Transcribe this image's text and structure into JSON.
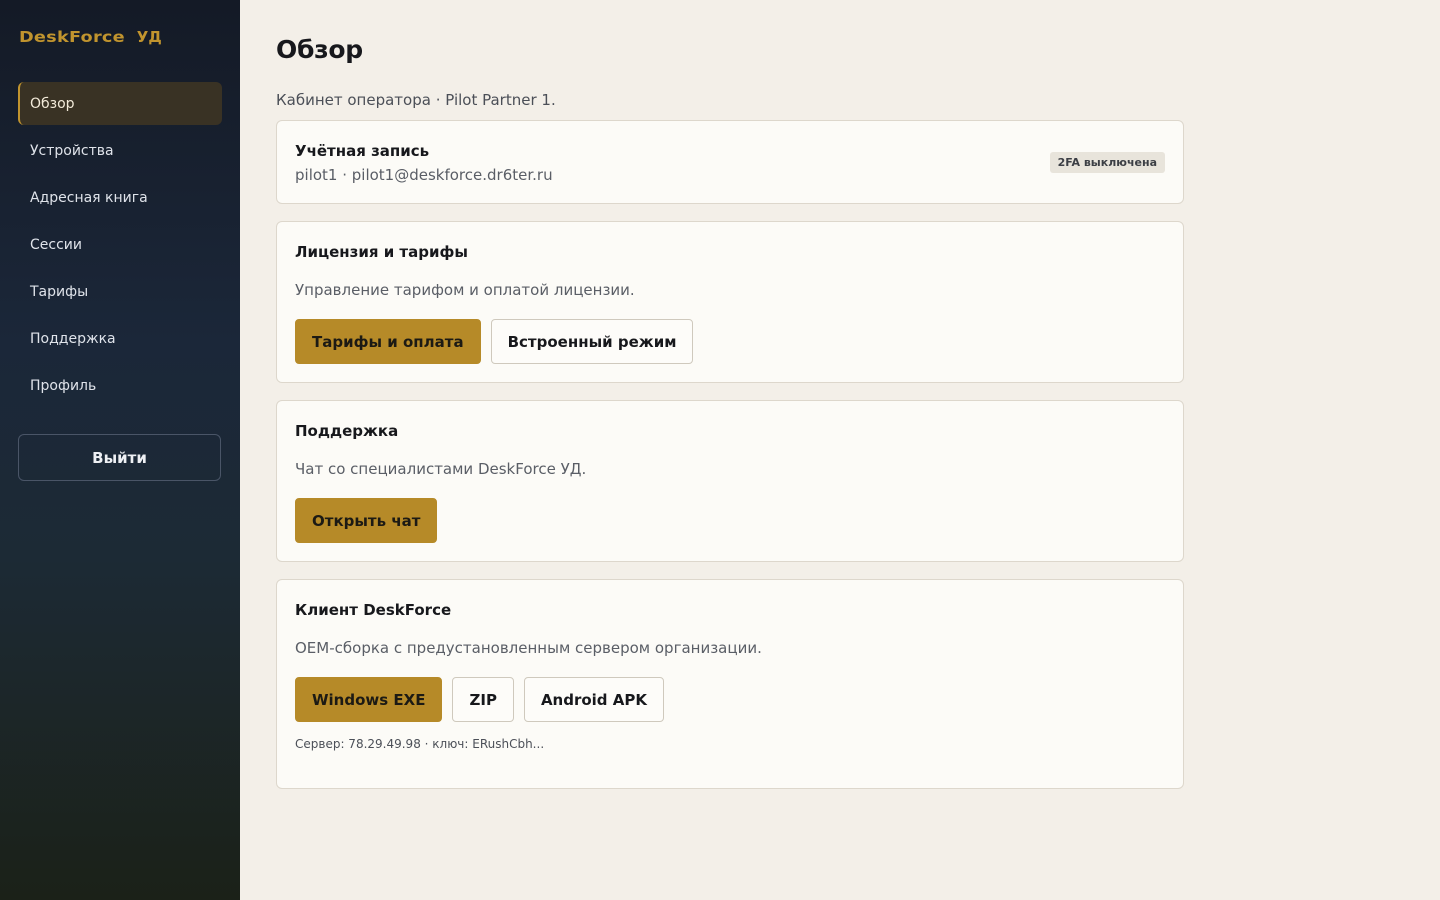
{
  "sidebar": {
    "brand": {
      "name": "DeskForce",
      "suffix": "УД"
    },
    "items": [
      {
        "label": "Обзор",
        "active": true
      },
      {
        "label": "Устройства"
      },
      {
        "label": "Адресная книга"
      },
      {
        "label": "Сессии"
      },
      {
        "label": "Тарифы"
      },
      {
        "label": "Поддержка"
      },
      {
        "label": "Профиль"
      }
    ],
    "logout_label": "Выйти"
  },
  "main": {
    "title": "Обзор",
    "subtitle": "Кабинет оператора · Pilot Partner 1.",
    "account": {
      "title": "Учётная запись",
      "line": "pilot1 · pilot1@deskforce.dr6ter.ru",
      "badge": "2FA выключена"
    },
    "license": {
      "title": "Лицензия и тарифы",
      "text": "Управление тарифом и оплатой лицензии.",
      "primary_button": "Тарифы и оплата",
      "secondary_button": "Встроенный режим"
    },
    "support": {
      "title": "Поддержка",
      "text": "Чат со специалистами DeskForce УД.",
      "button": "Открыть чат"
    },
    "client": {
      "title": "Клиент DeskForce",
      "text": "OEM-сборка с предустановленным сервером организации.",
      "buttons": [
        "Windows EXE",
        "ZIP",
        "Android APK"
      ],
      "meta": "Сервер: 78.29.49.98 · ключ: ERushCbh..."
    }
  },
  "colors": {
    "accent": "#b68a28",
    "brand": "#c1942e",
    "sidebar_top": "#141a26",
    "sidebar_bottom": "#1b2118",
    "main_bg": "#f3efe8",
    "card_bg": "#fcfbf7"
  }
}
